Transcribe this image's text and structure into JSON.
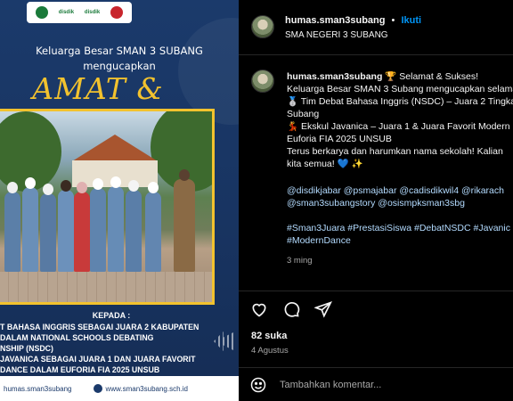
{
  "poster": {
    "logo_labels": [
      "disdik",
      "disdik"
    ],
    "line1": "Keluarga Besar SMAN 3 SUBANG",
    "line2": "mengucapkan",
    "headline": "AMAT & SUKSES",
    "kepada": "KEPADA :",
    "lines": [
      "T BAHASA INGGRIS SEBAGAI JUARA 2 KABUPATEN",
      "DALAM NATIONAL SCHOOLS DEBATING",
      "NSHIP (NSDC)",
      "JAVANICA SEBAGAI JUARA 1 DAN JUARA FAVORIT",
      "DANCE DALAM EUFORIA FIA 2025 UNSUB"
    ],
    "footer_ig": "humas.sman3subang",
    "footer_web": "www.sman3subang.sch.id"
  },
  "header": {
    "username": "humas.sman3subang",
    "dot": "•",
    "follow": "Ikuti",
    "subtitle": "SMA NEGERI 3 SUBANG"
  },
  "caption": {
    "username": "humas.sman3subang",
    "line1": "🏆 Selamat & Sukses!",
    "line2": "Keluarga Besar SMAN 3 Subang mengucapkan selamat",
    "line3": "🥈 Tim Debat Bahasa Inggris (NSDC) – Juara 2 Tingkat",
    "line4": "Subang",
    "line5": "💃 Ekskul Javanica – Juara 1 & Juara Favorit Modern",
    "line6": "Euforia FIA 2025 UNSUB",
    "line7": "Terus berkarya dan harumkan nama sekolah! Kalian",
    "line8": "kita semua! 💙 ✨",
    "mentions1": "@disdikjabar @psmajabar @cadisdikwil4 @rikarach",
    "mentions2": "@sman3subangstory @osismpksman3sbg",
    "tags1": "#Sman3Juara #PrestasiSiswa #DebatNSDC #Javanic",
    "tags2": "#ModernDance",
    "age": "3 ming"
  },
  "footer": {
    "likes": "82 suka",
    "date": "4 Agustus",
    "comment_placeholder": "Tambahkan komentar..."
  },
  "colors": {
    "accent_blue": "#0095f6",
    "poster_navy": "#1b3a6b",
    "poster_gold": "#f2c22e"
  }
}
